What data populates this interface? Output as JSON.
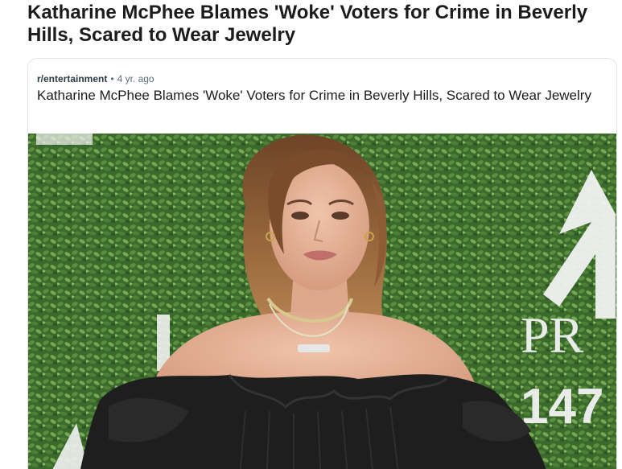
{
  "page": {
    "title": "Katharine McPhee Blames 'Woke' Voters for Crime in Beverly Hills, Scared to Wear Jewelry"
  },
  "post": {
    "subreddit": "r/entertainment",
    "separator": "•",
    "time_ago": "4 yr. ago",
    "title": "Katharine McPhee Blames 'Woke' Voters for Crime in Beverly Hills, Scared to Wear Jewelry"
  },
  "media": {
    "backdrop_text_1": "PR",
    "backdrop_text_2": "147",
    "colors": {
      "hedge": "#3f6b2f",
      "hedge_light": "#6f9c4c",
      "skin": "#e7b49a",
      "hair": "#8a5a36",
      "dress": "#1e1e1e"
    }
  }
}
